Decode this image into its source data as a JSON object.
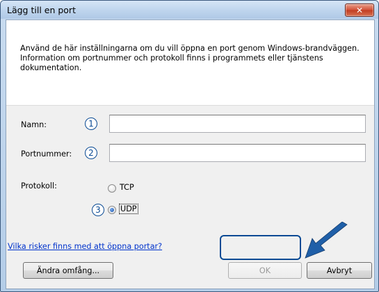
{
  "window": {
    "title": "Lägg till en port",
    "close_symbol": "✕"
  },
  "description": "Använd de här inställningarna om du vill öppna en port genom Windows-brandväggen. Information om portnummer och protokoll finns i programmets eller tjänstens dokumentation.",
  "form": {
    "name_label": "Namn:",
    "name_value": "",
    "port_label": "Portnummer:",
    "port_value": "",
    "protocol_label": "Protokoll:",
    "protocol_options": [
      {
        "label": "TCP",
        "checked": false
      },
      {
        "label": "UDP",
        "checked": true
      }
    ]
  },
  "callouts": [
    "1",
    "2",
    "3"
  ],
  "link_text": "Vilka risker finns med att öppna portar?",
  "buttons": {
    "change_scope": "Ändra omfång...",
    "ok": "OK",
    "cancel": "Avbryt"
  },
  "colors": {
    "callout": "#0a4a94",
    "link": "#0033cc",
    "arrow": "#1f5fa8"
  },
  "icons": {
    "close": "close-icon",
    "pointer_arrow": "pointer-arrow-icon"
  }
}
